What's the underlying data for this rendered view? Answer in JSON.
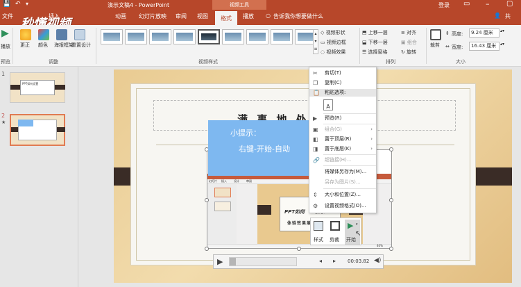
{
  "window": {
    "title": "演示文稿4 - PowerPoint",
    "context_tab_group": "视频工具",
    "login": "登录",
    "share": "共",
    "watermark": "秒懂视频"
  },
  "tabs": [
    "文件",
    "插入",
    "动画",
    "幻灯片放映",
    "审阅",
    "视图",
    "格式",
    "播放"
  ],
  "active_tab": "格式",
  "tell_me": "告诉我你想要做什么",
  "ribbon": {
    "preview_label": "播放",
    "group_preview": "预览",
    "adjust_buttons": [
      "更正",
      "颜色",
      "海报框架",
      "重置设计"
    ],
    "group_adjust": "调整",
    "group_video_styles": "视频样式",
    "style_options": [
      "视频形状",
      "视频边框",
      "视频效果"
    ],
    "arrange_buttons": [
      "上移一层",
      "下移一层",
      "选择窗格",
      "对齐",
      "组合",
      "旋转"
    ],
    "group_arrange": "排列",
    "crop_label": "裁剪",
    "height_label": "高度:",
    "height_value": "9.24 厘米",
    "width_label": "宽度:",
    "width_value": "16.43 厘米",
    "group_size": "大小"
  },
  "slides_pane": {
    "numbers": [
      "1",
      "2"
    ],
    "slide1_text": "PPT如何设置"
  },
  "slide": {
    "title_fragment": "满 事 地 处",
    "tip_title": "小提示：",
    "tip_body": "右键-开始-自动"
  },
  "video_content": {
    "tabs": [
      "幻灯片",
      "插入",
      "设计",
      "审阅"
    ],
    "slide_text_1": "PPT如何",
    "slide_text_2": "演示",
    "slide_text_3": "体验效果展示",
    "zoom": "40%"
  },
  "context_menu": {
    "items": [
      {
        "label": "剪切(T)",
        "icon": "scissors-icon",
        "glyph": "✂",
        "disabled": false,
        "submenu": false
      },
      {
        "label": "复制(C)",
        "icon": "copy-icon",
        "glyph": "❐",
        "disabled": false,
        "submenu": false
      },
      {
        "label": "粘贴选项:",
        "icon": "paste-icon",
        "glyph": "📋",
        "disabled": false,
        "submenu": false
      },
      {
        "label": "预览(R)",
        "icon": "preview-icon",
        "glyph": "▶",
        "disabled": false,
        "submenu": false
      },
      {
        "label": "组合(G)",
        "icon": "group-icon",
        "glyph": "▣",
        "disabled": true,
        "submenu": true
      },
      {
        "label": "置于顶层(R)",
        "icon": "bring-front-icon",
        "glyph": "◧",
        "disabled": false,
        "submenu": true
      },
      {
        "label": "置于底层(K)",
        "icon": "send-back-icon",
        "glyph": "◨",
        "disabled": false,
        "submenu": true
      },
      {
        "label": "超链接(H)...",
        "icon": "hyperlink-icon",
        "glyph": "🔗",
        "disabled": true,
        "submenu": false
      },
      {
        "label": "将媒体另存为(M)...",
        "icon": "save-media-icon",
        "glyph": "",
        "disabled": false,
        "submenu": false
      },
      {
        "label": "另存为图片(S)...",
        "icon": "save-picture-icon",
        "glyph": "",
        "disabled": true,
        "submenu": false
      },
      {
        "label": "大小和位置(Z)...",
        "icon": "size-position-icon",
        "glyph": "⇕",
        "disabled": false,
        "submenu": false
      },
      {
        "label": "设置视频格式(O)...",
        "icon": "format-video-icon",
        "glyph": "⚙",
        "disabled": false,
        "submenu": false
      }
    ]
  },
  "mini_toolbar": {
    "style_label": "样式",
    "crop_label": "剪裁",
    "start_label": "开始"
  },
  "player": {
    "time": "00:03.82"
  }
}
